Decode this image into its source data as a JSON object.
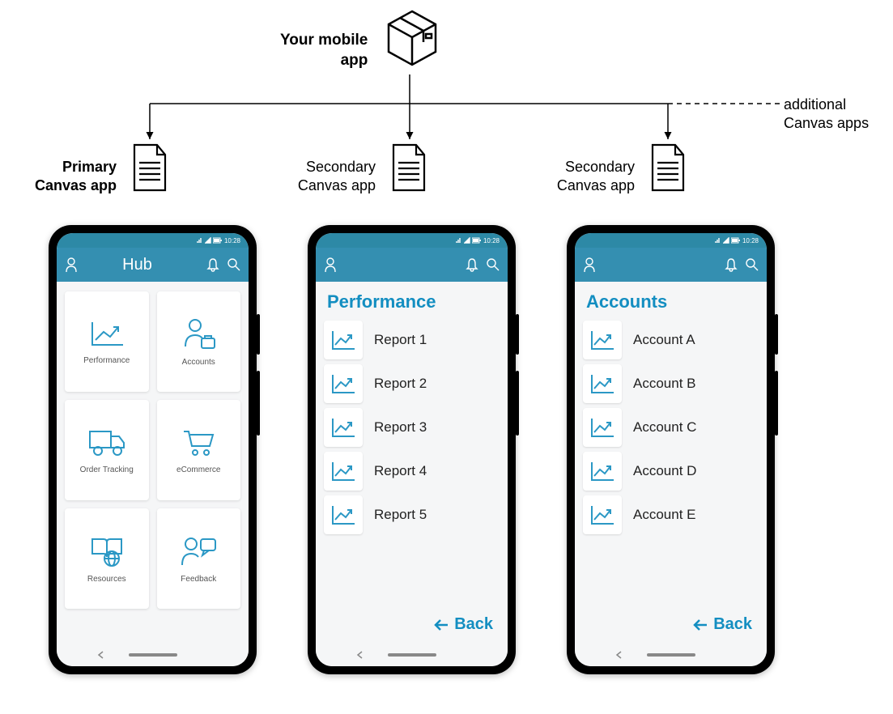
{
  "top_label": "Your mobile\napp",
  "extra_label": "additional\nCanvas apps",
  "docs": [
    {
      "label": "Primary\nCanvas app",
      "bold": true
    },
    {
      "label": "Secondary\nCanvas app",
      "bold": false
    },
    {
      "label": "Secondary\nCanvas app",
      "bold": false
    }
  ],
  "status_time": "10:28",
  "phones": {
    "hub": {
      "title": "Hub",
      "tiles": [
        {
          "label": "Performance",
          "icon": "chart"
        },
        {
          "label": "Accounts",
          "icon": "person-briefcase"
        },
        {
          "label": "Order Tracking",
          "icon": "truck"
        },
        {
          "label": "eCommerce",
          "icon": "cart"
        },
        {
          "label": "Resources",
          "icon": "book-globe"
        },
        {
          "label": "Feedback",
          "icon": "person-chat"
        }
      ]
    },
    "performance": {
      "title": "Performance",
      "items": [
        "Report 1",
        "Report 2",
        "Report 3",
        "Report 4",
        "Report 5"
      ],
      "back": "Back"
    },
    "accounts": {
      "title": "Accounts",
      "items": [
        "Account A",
        "Account B",
        "Account C",
        "Account D",
        "Account E"
      ],
      "back": "Back"
    }
  }
}
